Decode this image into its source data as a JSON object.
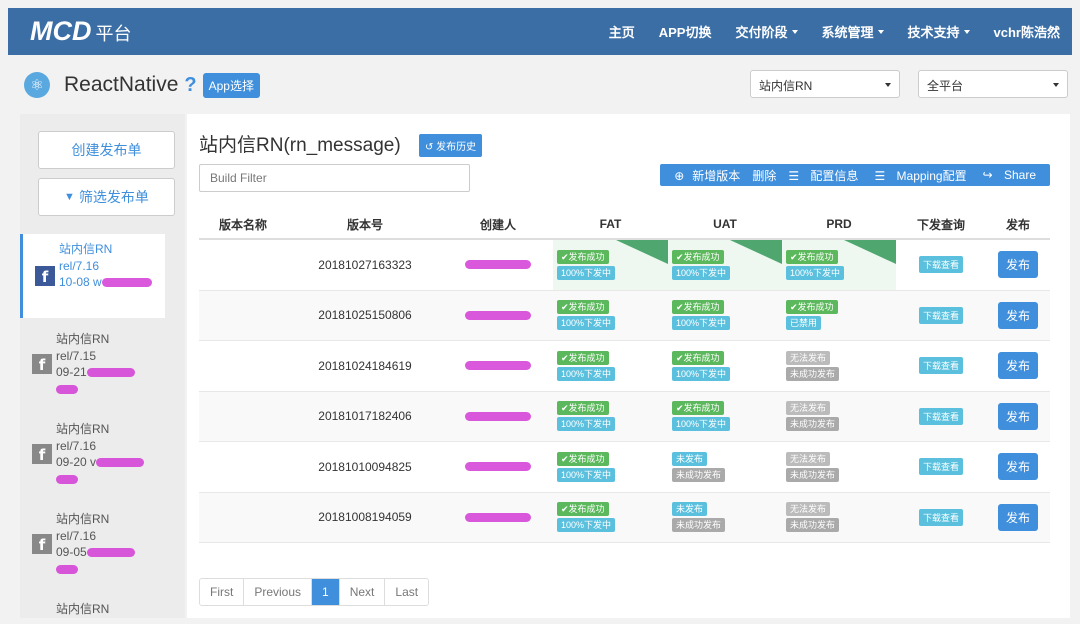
{
  "navbar": {
    "brand": "MCD",
    "brand_sub": "平台",
    "items": [
      {
        "label": "主页",
        "dropdown": false
      },
      {
        "label": "APP切换",
        "dropdown": false
      },
      {
        "label": "交付阶段",
        "dropdown": true
      },
      {
        "label": "系统管理",
        "dropdown": true
      },
      {
        "label": "技术支持",
        "dropdown": true
      },
      {
        "label": "vchr陈浩然",
        "dropdown": false
      }
    ]
  },
  "subheader": {
    "app_title": "ReactNative",
    "help": "?",
    "app_select": "App选择",
    "select_module": "站内信RN",
    "select_platform": "全平台"
  },
  "sidebar": {
    "create_button": "创建发布单",
    "filter_button": "筛选发布单",
    "items": [
      {
        "name": "站内信RN",
        "version": "rel/7.16",
        "date": "10-08 w",
        "active": true
      },
      {
        "name": "站内信RN",
        "version": "rel/7.15",
        "date": "09-21",
        "active": false
      },
      {
        "name": "站内信RN",
        "version": "rel/7.16",
        "date": "09-20 v",
        "active": false
      },
      {
        "name": "站内信RN",
        "version": "rel/7.16",
        "date": "09-05",
        "active": false
      },
      {
        "name": "站内信RN",
        "version": "",
        "date": "",
        "active": false
      }
    ]
  },
  "main": {
    "title": "站内信RN(rn_message)",
    "history_button": "发布历史",
    "filter_placeholder": "Build Filter",
    "toolbar": {
      "add_version": "新增版本",
      "delete": "删除",
      "config": "配置信息",
      "mapping": "Mapping配置",
      "share": "Share"
    },
    "table": {
      "headers": [
        "版本名称",
        "版本号",
        "创建人",
        "FAT",
        "UAT",
        "PRD",
        "下发查询",
        "发布"
      ],
      "download_label": "下载查看",
      "publish_label": "发布",
      "rows": [
        {
          "version_name": "",
          "version_no": "20181027163323",
          "fat": [
            "✔发布成功",
            "100%下发中"
          ],
          "uat": [
            "✔发布成功",
            "100%下发中"
          ],
          "prd": [
            "✔发布成功",
            "100%下发中"
          ],
          "highlight": true
        },
        {
          "version_name": "",
          "version_no": "20181025150806",
          "fat": [
            "✔发布成功",
            "100%下发中"
          ],
          "uat": [
            "✔发布成功",
            "100%下发中"
          ],
          "prd": [
            "✔发布成功",
            "已禁用"
          ],
          "highlight": false
        },
        {
          "version_name": "",
          "version_no": "20181024184619",
          "fat": [
            "✔发布成功",
            "100%下发中"
          ],
          "uat": [
            "✔发布成功",
            "100%下发中"
          ],
          "prd": [
            "无法发布",
            "未成功发布"
          ],
          "highlight": false
        },
        {
          "version_name": "",
          "version_no": "20181017182406",
          "fat": [
            "✔发布成功",
            "100%下发中"
          ],
          "uat": [
            "✔发布成功",
            "100%下发中"
          ],
          "prd": [
            "无法发布",
            "未成功发布"
          ],
          "highlight": false
        },
        {
          "version_name": "",
          "version_no": "20181010094825",
          "fat": [
            "✔发布成功",
            "100%下发中"
          ],
          "uat": [
            "未发布",
            "未成功发布"
          ],
          "prd": [
            "无法发布",
            "未成功发布"
          ],
          "highlight": false
        },
        {
          "version_name": "",
          "version_no": "20181008194059",
          "fat": [
            "✔发布成功",
            "100%下发中"
          ],
          "uat": [
            "未发布",
            "未成功发布"
          ],
          "prd": [
            "无法发布",
            "未成功发布"
          ],
          "highlight": false
        }
      ]
    },
    "pager": [
      "First",
      "Previous",
      "1",
      "Next",
      "Last"
    ]
  }
}
